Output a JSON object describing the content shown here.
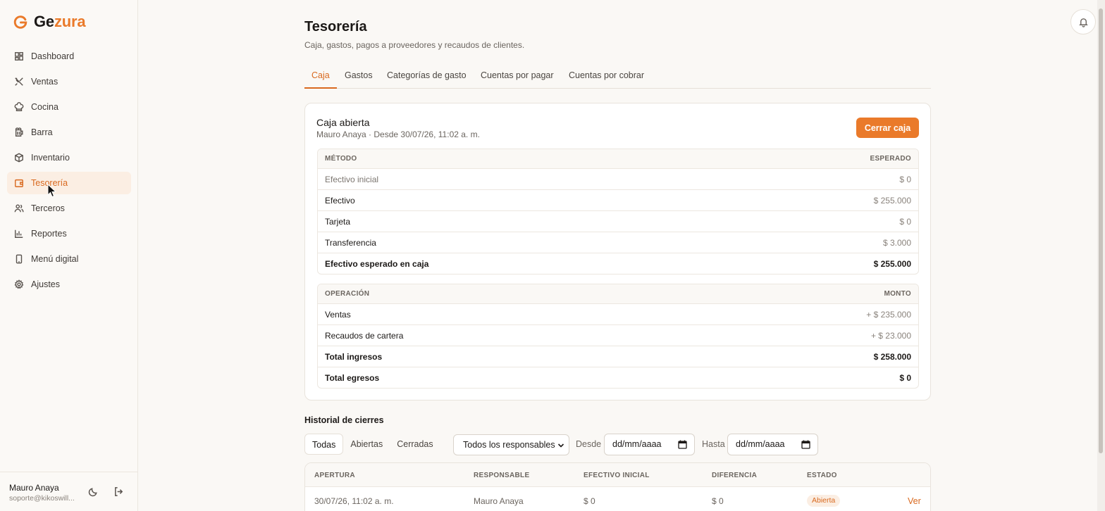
{
  "brand": {
    "part1": "Ge",
    "part2": "zura",
    "accent": "#ea7a2a"
  },
  "sidebar": {
    "items": [
      {
        "label": "Dashboard",
        "icon": "dashboard-icon"
      },
      {
        "label": "Ventas",
        "icon": "utensils-icon"
      },
      {
        "label": "Cocina",
        "icon": "chef-hat-icon"
      },
      {
        "label": "Barra",
        "icon": "beer-icon"
      },
      {
        "label": "Inventario",
        "icon": "box-icon"
      },
      {
        "label": "Tesorería",
        "icon": "wallet-icon",
        "active": true
      },
      {
        "label": "Terceros",
        "icon": "users-icon"
      },
      {
        "label": "Reportes",
        "icon": "bar-chart-icon"
      },
      {
        "label": "Menú digital",
        "icon": "smartphone-icon"
      },
      {
        "label": "Ajustes",
        "icon": "gear-icon"
      }
    ],
    "user": {
      "name": "Mauro Anaya",
      "email": "soporte@kikoswill..."
    }
  },
  "header": {
    "title": "Tesorería",
    "subtitle": "Caja, gastos, pagos a proveedores y recaudos de clientes."
  },
  "tabs": [
    {
      "label": "Caja",
      "active": true
    },
    {
      "label": "Gastos"
    },
    {
      "label": "Categorías de gasto"
    },
    {
      "label": "Cuentas por pagar"
    },
    {
      "label": "Cuentas por cobrar"
    }
  ],
  "caja": {
    "title": "Caja abierta",
    "subtitle": "Mauro Anaya · Desde 30/07/26, 11:02 a. m.",
    "close_button": "Cerrar caja",
    "methods": {
      "headers": [
        "MÉTODO",
        "ESPERADO"
      ],
      "rows": [
        {
          "label": "Efectivo inicial",
          "value": "$ 0"
        },
        {
          "label": "Efectivo",
          "value": "$ 255.000"
        },
        {
          "label": "Tarjeta",
          "value": "$ 0"
        },
        {
          "label": "Transferencia",
          "value": "$ 3.000"
        },
        {
          "label": "Efectivo esperado en caja",
          "value": "$ 255.000"
        }
      ]
    },
    "operations": {
      "headers": [
        "OPERACIÓN",
        "MONTO"
      ],
      "rows": [
        {
          "label": "Ventas",
          "value": "+ $ 235.000"
        },
        {
          "label": "Recaudos de cartera",
          "value": "+ $ 23.000"
        },
        {
          "label": "Total ingresos",
          "value": "$ 258.000"
        },
        {
          "label": "Total egresos",
          "value": "$ 0"
        }
      ]
    }
  },
  "history": {
    "title": "Historial de cierres",
    "filters": [
      "Todas",
      "Abiertas",
      "Cerradas"
    ],
    "responsible_select": "Todos los responsables",
    "from_label": "Desde",
    "to_label": "Hasta",
    "date_placeholder": "dd/mm/aaaa",
    "columns": [
      "APERTURA",
      "RESPONSABLE",
      "EFECTIVO INICIAL",
      "DIFERENCIA",
      "ESTADO"
    ],
    "rows": [
      {
        "apertura": "30/07/26, 11:02 a. m.",
        "responsable": "Mauro Anaya",
        "efectivo_inicial": "$ 0",
        "diferencia": "$ 0",
        "estado": "Abierta",
        "action": "Ver"
      }
    ]
  }
}
